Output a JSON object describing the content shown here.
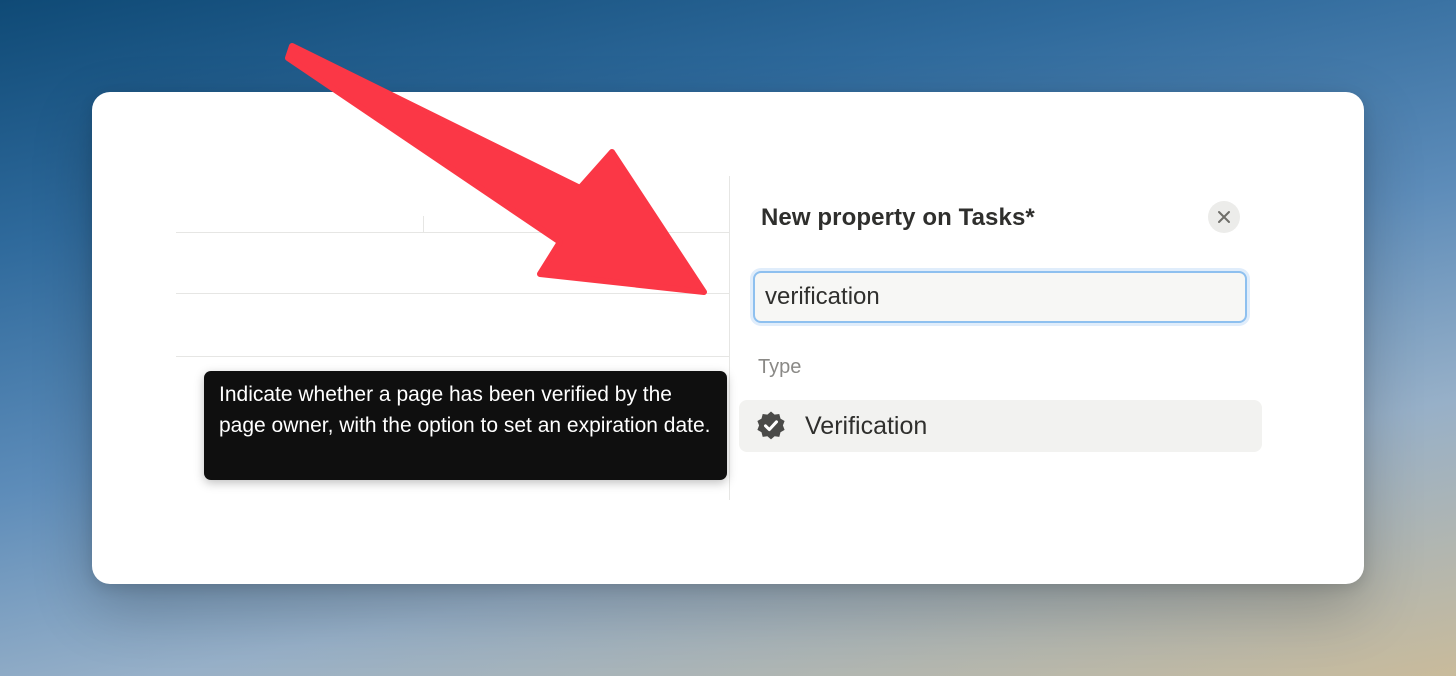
{
  "panel": {
    "title": "New property on Tasks*",
    "search_value": "verification",
    "type_label": "Type",
    "type_option": {
      "label": "Verification",
      "icon": "verified-badge-icon"
    }
  },
  "tooltip": {
    "text": "Indicate whether a page has been verified by the page owner, with the option to set an expiration date."
  },
  "colors": {
    "annotation_arrow": "#fb3746",
    "input_focus_border": "#8ec0ef",
    "tooltip_bg": "#0f0f0f",
    "option_hover_bg": "#f2f2f0"
  }
}
